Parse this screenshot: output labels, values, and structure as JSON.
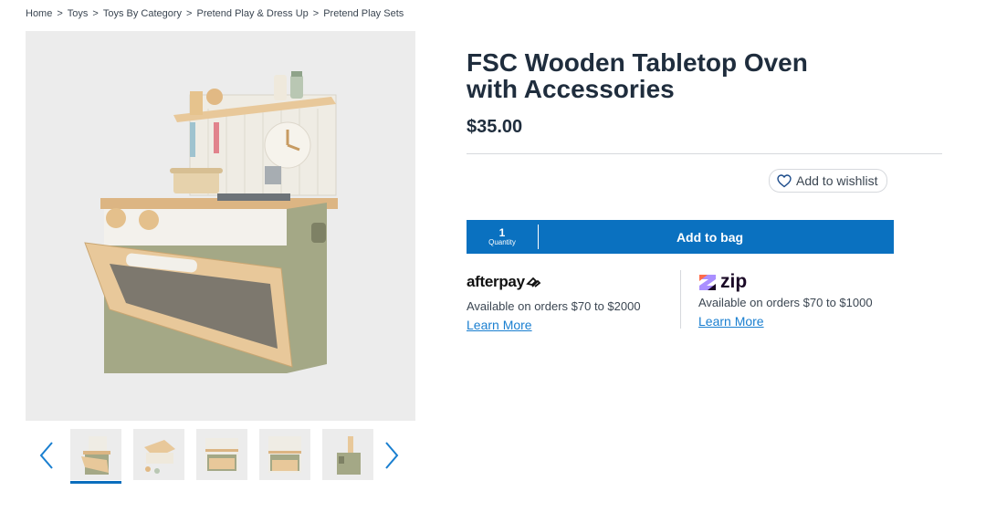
{
  "breadcrumb": {
    "items": [
      "Home",
      "Toys",
      "Toys By Category",
      "Pretend Play & Dress Up",
      "Pretend Play Sets"
    ],
    "separator": ">"
  },
  "product": {
    "title": "FSC Wooden Tabletop Oven with Accessories",
    "price": "$35.00"
  },
  "gallery": {
    "prev_icon": "chevron-left-icon",
    "next_icon": "chevron-right-icon",
    "active_thumbnail": 1,
    "thumbnail_count": 5
  },
  "wishlist": {
    "label": "Add to wishlist",
    "icon": "heart-icon"
  },
  "cart": {
    "quantity_value": "1",
    "quantity_label": "Quantity",
    "add_label": "Add to bag"
  },
  "payments": {
    "afterpay": {
      "brand": "afterpay",
      "availability": "Available on orders $70 to $2000",
      "link": "Learn More"
    },
    "zip": {
      "brand": "zip",
      "availability": "Available on orders $70 to $1000",
      "link": "Learn More"
    }
  },
  "colors": {
    "primary_blue": "#0a71c0",
    "link_blue": "#1a7fd0",
    "text_dark": "#1f2d3d",
    "image_bg": "#ececec",
    "oven_green": "#a4a886",
    "wood": "#e8c89a"
  }
}
